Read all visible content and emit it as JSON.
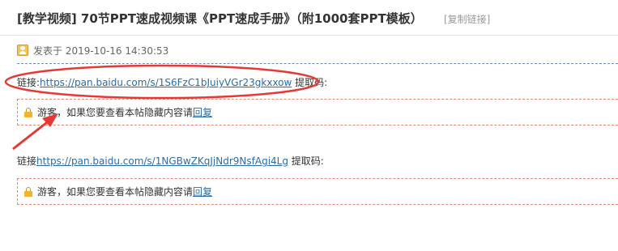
{
  "thread": {
    "title": "[教学视频] 70节PPT速成视频课《PPT速成手册》（附1000套PPT模板）",
    "copy_link_label": "[复制链接]"
  },
  "post": {
    "posted_at": "发表于 2019-10-16 14:30:53",
    "links": [
      {
        "prefix": "链接:",
        "url": "https://pan.baidu.com/s/1S6FzC1bJuiyVGr23gkxxow",
        "code_label": " 提取码:"
      },
      {
        "prefix": "链接",
        "url": "https://pan.baidu.com/s/1NGBwZKqJjNdr9NsfAgi4Lg",
        "code_label": " 提取码:"
      }
    ],
    "hidden_notice": {
      "text": "游客，如果您要查看本帖隐藏内容请",
      "reply_label": "回复"
    }
  },
  "annotation": {
    "color": "#e53935"
  },
  "icons": {
    "author": "author-icon",
    "lock": "lock-icon"
  }
}
